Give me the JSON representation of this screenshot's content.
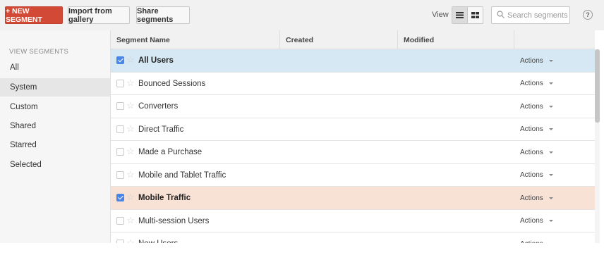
{
  "toolbar": {
    "new_segment": "+ NEW SEGMENT",
    "import_gallery": "Import from gallery",
    "share_segments": "Share segments",
    "view_label": "View",
    "search_placeholder": "Search segments",
    "help_symbol": "?"
  },
  "sidebar": {
    "heading": "VIEW SEGMENTS",
    "items": [
      {
        "label": "All"
      },
      {
        "label": "System"
      },
      {
        "label": "Custom"
      },
      {
        "label": "Shared"
      },
      {
        "label": "Starred"
      },
      {
        "label": "Selected"
      }
    ],
    "active_index": 1
  },
  "table": {
    "columns": [
      "Segment Name",
      "Created",
      "Modified",
      ""
    ],
    "rows": [
      {
        "name": "All Users",
        "checked": true,
        "actions": "Actions"
      },
      {
        "name": "Bounced Sessions",
        "checked": false,
        "actions": "Actions"
      },
      {
        "name": "Converters",
        "checked": false,
        "actions": "Actions"
      },
      {
        "name": "Direct Traffic",
        "checked": false,
        "actions": "Actions"
      },
      {
        "name": "Made a Purchase",
        "checked": false,
        "actions": "Actions"
      },
      {
        "name": "Mobile and Tablet Traffic",
        "checked": false,
        "actions": "Actions"
      },
      {
        "name": "Mobile Traffic",
        "checked": true,
        "actions": "Actions"
      },
      {
        "name": "Multi-session Users",
        "checked": false,
        "actions": "Actions"
      },
      {
        "name": "New Users",
        "checked": false,
        "actions": "Actions"
      }
    ]
  },
  "colors": {
    "accent_red": "#d24a36",
    "selected_blue": "#d6e8f3",
    "selected_peach": "#f8e1d5",
    "checkbox_blue": "#4a86e8"
  },
  "icons": {
    "view_list": "list-view-icon",
    "view_grid": "grid-view-icon",
    "search": "search-icon",
    "star": "star-icon",
    "caret": "caret-down-icon"
  }
}
